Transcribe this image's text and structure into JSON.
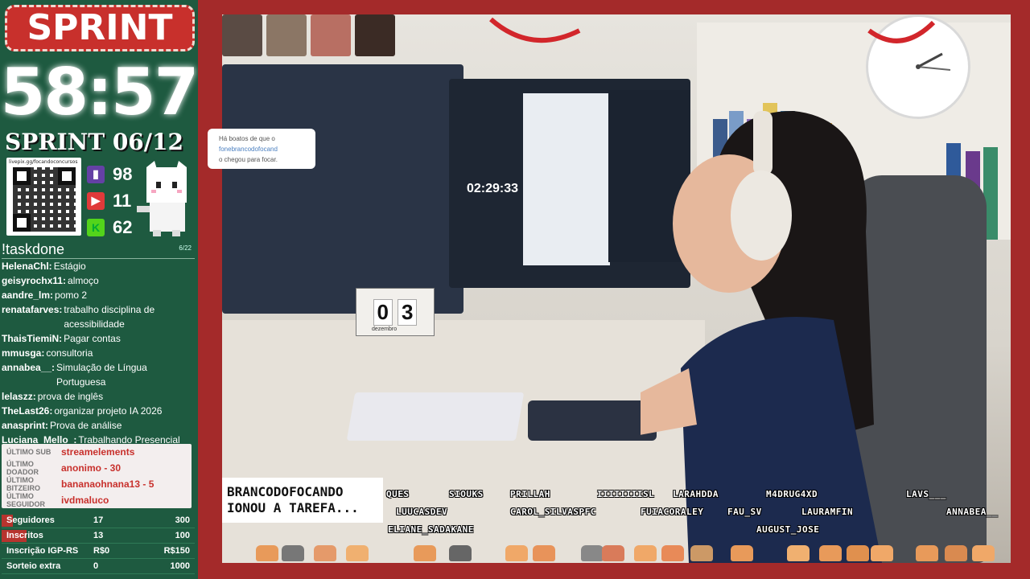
{
  "overlay": {
    "badge": "SPRINT",
    "timer": "58:57",
    "sprint_label": "SPRINT 06/12",
    "qr_caption": "livepix.gg/focandoconcursos",
    "stats": [
      {
        "icon": "twitch-icon",
        "value": "98",
        "color": "#6441a5"
      },
      {
        "icon": "youtube-icon",
        "value": "11",
        "color": "#e03a3a"
      },
      {
        "icon": "kick-icon",
        "value": "62",
        "color": "#53d41b"
      }
    ],
    "task_command": "!taskdone",
    "task_count": "6/22",
    "tasks": [
      {
        "user": "HelenaChl:",
        "task": "Estágio"
      },
      {
        "user": "geisyrochx11:",
        "task": "almoço"
      },
      {
        "user": "aandre_lm:",
        "task": "pomo 2"
      },
      {
        "user": "renatafarves:",
        "task": "trabalho disciplina de acessibilidade"
      },
      {
        "user": "ThaisTiemiN:",
        "task": "Pagar contas"
      },
      {
        "user": "mmusga:",
        "task": "consultoria"
      },
      {
        "user": "annabea__:",
        "task": "Simulação de Língua Portuguesa"
      },
      {
        "user": "lelaszz:",
        "task": "prova de inglês"
      },
      {
        "user": "TheLast26:",
        "task": "organizar projeto IA 2026"
      },
      {
        "user": "anasprint:",
        "task": "Prova de análise"
      },
      {
        "user": "Luciana_Mello_:",
        "task": "Trabalhando Presencial"
      }
    ],
    "recent": [
      {
        "label": "ÚLTIMO SUB",
        "value": "streamelements"
      },
      {
        "label": "ÚLTIMO DOADOR",
        "value": "anonimo - 30"
      },
      {
        "label": "ÚLTIMO BITZEIRO",
        "value": "bananaohnana13 - 5"
      },
      {
        "label": "ÚLTIMO SEGUIDOR",
        "value": "ivdmaluco"
      }
    ],
    "goals": [
      {
        "label": "Seguidores",
        "current": "17",
        "target": "300",
        "progress": 0.06
      },
      {
        "label": "Inscritos",
        "current": "13",
        "target": "100",
        "progress": 0.13
      },
      {
        "label": "Inscrição IGP-RS",
        "current": "R$0",
        "target": "R$150",
        "progress": 0
      },
      {
        "label": "Sorteio extra",
        "current": "0",
        "target": "1000",
        "progress": 0
      }
    ]
  },
  "notification": {
    "line1": "Há boatos de que o",
    "user": "fonebrancodofocand",
    "line3": "o chegou para focar."
  },
  "scene": {
    "screen_timer": "02:29:33",
    "cube_digits": [
      "0",
      "3"
    ],
    "cube_month": "dezembro"
  },
  "chat_scroll": {
    "line1": "BRANCODOFOCANDO",
    "line2": "IONOU A TAREFA..."
  },
  "chatters": [
    {
      "name": "QUES"
    },
    {
      "name": "SIOUKS"
    },
    {
      "name": "PRILLAH"
    },
    {
      "name": "IIIIIIIISL"
    },
    {
      "name": "LARAHDDA"
    },
    {
      "name": "M4DRUG4XD"
    },
    {
      "name": "LAVS___"
    },
    {
      "name": "LUUCASDEV"
    },
    {
      "name": "CAROL_SILVASPFC"
    },
    {
      "name": "FUIACORALEY"
    },
    {
      "name": "FAU_SV"
    },
    {
      "name": "LAURAMFIN"
    },
    {
      "name": "ANNABEA__"
    },
    {
      "name": "ELIANE_SADAKANE"
    },
    {
      "name": "AUGUST_JOSE"
    }
  ],
  "colors": {
    "panel_green": "#1e5a40",
    "frame_red": "#a42a2a",
    "accent_red": "#c8302c"
  }
}
